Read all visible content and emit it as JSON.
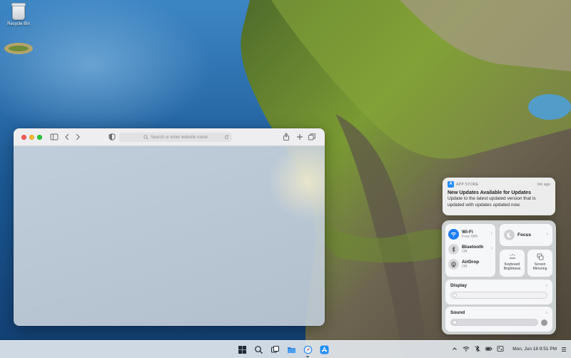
{
  "desktop": {
    "icons": [
      {
        "label": "Recycle Bin",
        "icon": "trash-bin-icon"
      }
    ]
  },
  "safari": {
    "address_placeholder": "Search or enter website name",
    "toolbar_icons": [
      "sidebar-icon",
      "back-icon",
      "forward-icon",
      "privacy-shield-icon",
      "share-icon",
      "new-tab-icon",
      "tabs-overview-icon"
    ]
  },
  "notification": {
    "app": "APP STORE",
    "time": "0m ago",
    "title": "New Updates Available for Updates",
    "body": "Update to the latest updated version that is updated with updates updated now."
  },
  "control_center": {
    "wifi": {
      "label": "Wi-Fi",
      "status": "Free Wifi"
    },
    "bluetooth": {
      "label": "Bluetooth",
      "status": "Off"
    },
    "airdrop": {
      "label": "AirDrop",
      "status": "Off"
    },
    "focus": {
      "label": "Focus"
    },
    "keyboard_brightness": {
      "label": "Keyboard Brightness"
    },
    "screen_mirroring": {
      "label": "Screen Mirroring"
    },
    "display": {
      "label": "Display"
    },
    "sound": {
      "label": "Sound"
    },
    "colors": {
      "accent": "#1e7cf6"
    }
  },
  "taskbar": {
    "apps": [
      "windows-start-icon",
      "search-icon",
      "task-view-icon",
      "file-explorer-icon",
      "safari-icon",
      "app-store-icon"
    ],
    "clock": "Mon, Jun 18 9:51 PM"
  }
}
